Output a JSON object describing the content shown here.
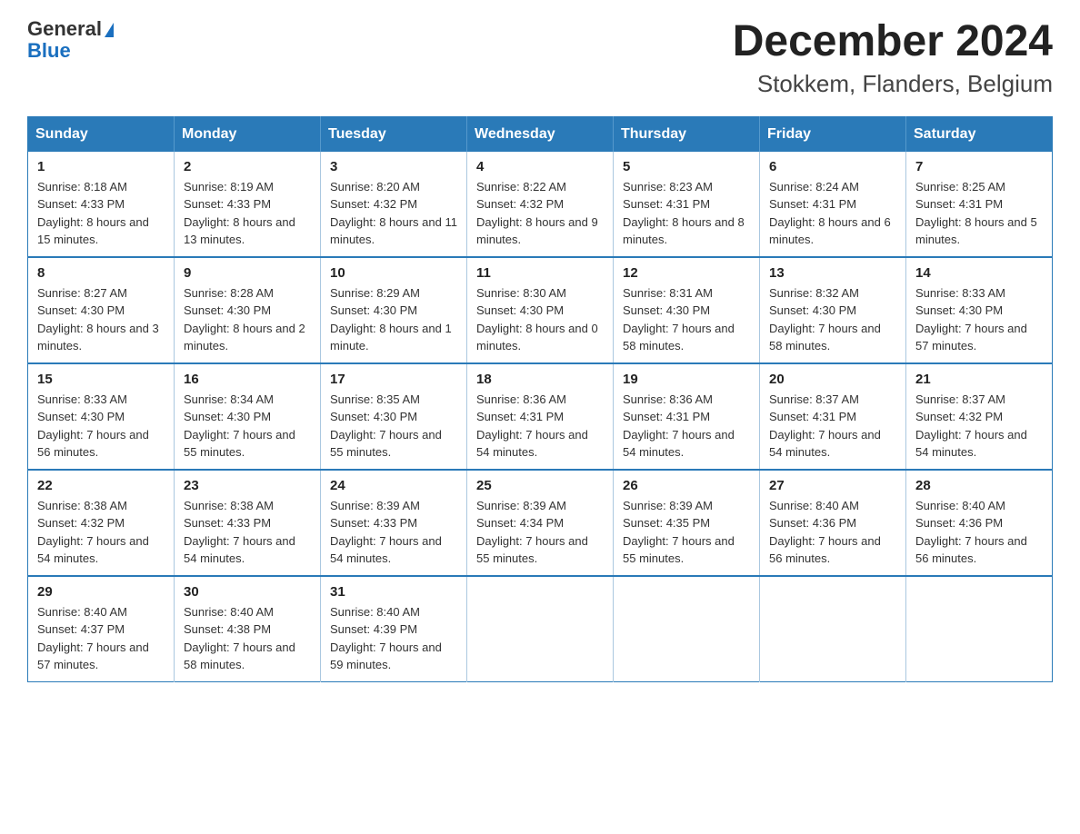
{
  "logo": {
    "general": "General",
    "blue": "Blue"
  },
  "title": "December 2024",
  "subtitle": "Stokkem, Flanders, Belgium",
  "days_of_week": [
    "Sunday",
    "Monday",
    "Tuesday",
    "Wednesday",
    "Thursday",
    "Friday",
    "Saturday"
  ],
  "weeks": [
    [
      {
        "day": "1",
        "sunrise": "8:18 AM",
        "sunset": "4:33 PM",
        "daylight": "8 hours and 15 minutes."
      },
      {
        "day": "2",
        "sunrise": "8:19 AM",
        "sunset": "4:33 PM",
        "daylight": "8 hours and 13 minutes."
      },
      {
        "day": "3",
        "sunrise": "8:20 AM",
        "sunset": "4:32 PM",
        "daylight": "8 hours and 11 minutes."
      },
      {
        "day": "4",
        "sunrise": "8:22 AM",
        "sunset": "4:32 PM",
        "daylight": "8 hours and 9 minutes."
      },
      {
        "day": "5",
        "sunrise": "8:23 AM",
        "sunset": "4:31 PM",
        "daylight": "8 hours and 8 minutes."
      },
      {
        "day": "6",
        "sunrise": "8:24 AM",
        "sunset": "4:31 PM",
        "daylight": "8 hours and 6 minutes."
      },
      {
        "day": "7",
        "sunrise": "8:25 AM",
        "sunset": "4:31 PM",
        "daylight": "8 hours and 5 minutes."
      }
    ],
    [
      {
        "day": "8",
        "sunrise": "8:27 AM",
        "sunset": "4:30 PM",
        "daylight": "8 hours and 3 minutes."
      },
      {
        "day": "9",
        "sunrise": "8:28 AM",
        "sunset": "4:30 PM",
        "daylight": "8 hours and 2 minutes."
      },
      {
        "day": "10",
        "sunrise": "8:29 AM",
        "sunset": "4:30 PM",
        "daylight": "8 hours and 1 minute."
      },
      {
        "day": "11",
        "sunrise": "8:30 AM",
        "sunset": "4:30 PM",
        "daylight": "8 hours and 0 minutes."
      },
      {
        "day": "12",
        "sunrise": "8:31 AM",
        "sunset": "4:30 PM",
        "daylight": "7 hours and 58 minutes."
      },
      {
        "day": "13",
        "sunrise": "8:32 AM",
        "sunset": "4:30 PM",
        "daylight": "7 hours and 58 minutes."
      },
      {
        "day": "14",
        "sunrise": "8:33 AM",
        "sunset": "4:30 PM",
        "daylight": "7 hours and 57 minutes."
      }
    ],
    [
      {
        "day": "15",
        "sunrise": "8:33 AM",
        "sunset": "4:30 PM",
        "daylight": "7 hours and 56 minutes."
      },
      {
        "day": "16",
        "sunrise": "8:34 AM",
        "sunset": "4:30 PM",
        "daylight": "7 hours and 55 minutes."
      },
      {
        "day": "17",
        "sunrise": "8:35 AM",
        "sunset": "4:30 PM",
        "daylight": "7 hours and 55 minutes."
      },
      {
        "day": "18",
        "sunrise": "8:36 AM",
        "sunset": "4:31 PM",
        "daylight": "7 hours and 54 minutes."
      },
      {
        "day": "19",
        "sunrise": "8:36 AM",
        "sunset": "4:31 PM",
        "daylight": "7 hours and 54 minutes."
      },
      {
        "day": "20",
        "sunrise": "8:37 AM",
        "sunset": "4:31 PM",
        "daylight": "7 hours and 54 minutes."
      },
      {
        "day": "21",
        "sunrise": "8:37 AM",
        "sunset": "4:32 PM",
        "daylight": "7 hours and 54 minutes."
      }
    ],
    [
      {
        "day": "22",
        "sunrise": "8:38 AM",
        "sunset": "4:32 PM",
        "daylight": "7 hours and 54 minutes."
      },
      {
        "day": "23",
        "sunrise": "8:38 AM",
        "sunset": "4:33 PM",
        "daylight": "7 hours and 54 minutes."
      },
      {
        "day": "24",
        "sunrise": "8:39 AM",
        "sunset": "4:33 PM",
        "daylight": "7 hours and 54 minutes."
      },
      {
        "day": "25",
        "sunrise": "8:39 AM",
        "sunset": "4:34 PM",
        "daylight": "7 hours and 55 minutes."
      },
      {
        "day": "26",
        "sunrise": "8:39 AM",
        "sunset": "4:35 PM",
        "daylight": "7 hours and 55 minutes."
      },
      {
        "day": "27",
        "sunrise": "8:40 AM",
        "sunset": "4:36 PM",
        "daylight": "7 hours and 56 minutes."
      },
      {
        "day": "28",
        "sunrise": "8:40 AM",
        "sunset": "4:36 PM",
        "daylight": "7 hours and 56 minutes."
      }
    ],
    [
      {
        "day": "29",
        "sunrise": "8:40 AM",
        "sunset": "4:37 PM",
        "daylight": "7 hours and 57 minutes."
      },
      {
        "day": "30",
        "sunrise": "8:40 AM",
        "sunset": "4:38 PM",
        "daylight": "7 hours and 58 minutes."
      },
      {
        "day": "31",
        "sunrise": "8:40 AM",
        "sunset": "4:39 PM",
        "daylight": "7 hours and 59 minutes."
      },
      null,
      null,
      null,
      null
    ]
  ]
}
